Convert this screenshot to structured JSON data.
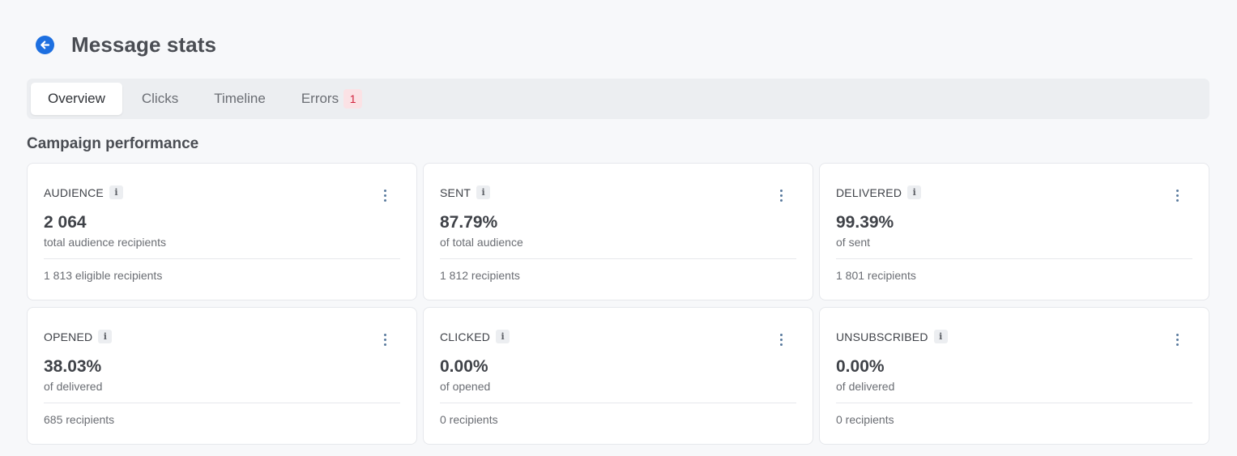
{
  "header": {
    "title": "Message stats",
    "back_icon": "arrow-left-circle-icon"
  },
  "tabs": [
    {
      "label": "Overview",
      "active": true
    },
    {
      "label": "Clicks",
      "active": false
    },
    {
      "label": "Timeline",
      "active": false
    },
    {
      "label": "Errors",
      "active": false,
      "badge": "1"
    }
  ],
  "section": {
    "title": "Campaign performance"
  },
  "cards": [
    {
      "label": "AUDIENCE",
      "value": "2 064",
      "sub": "total audience recipients",
      "foot": "1 813 eligible recipients"
    },
    {
      "label": "SENT",
      "value": "87.79%",
      "sub": "of total audience",
      "foot": "1 812 recipients"
    },
    {
      "label": "DELIVERED",
      "value": "99.39%",
      "sub": "of sent",
      "foot": "1 801 recipients"
    },
    {
      "label": "OPENED",
      "value": "38.03%",
      "sub": "of delivered",
      "foot": "685 recipients"
    },
    {
      "label": "CLICKED",
      "value": "0.00%",
      "sub": "of opened",
      "foot": "0 recipients"
    },
    {
      "label": "UNSUBSCRIBED",
      "value": "0.00%",
      "sub": "of delivered",
      "foot": "0 recipients"
    }
  ],
  "icons": {
    "info": "info-icon",
    "more": "more-vertical-icon"
  },
  "colors": {
    "accent": "#1d6fe0",
    "error_badge_bg": "#fbe2e5",
    "error_badge_text": "#d2233d"
  }
}
